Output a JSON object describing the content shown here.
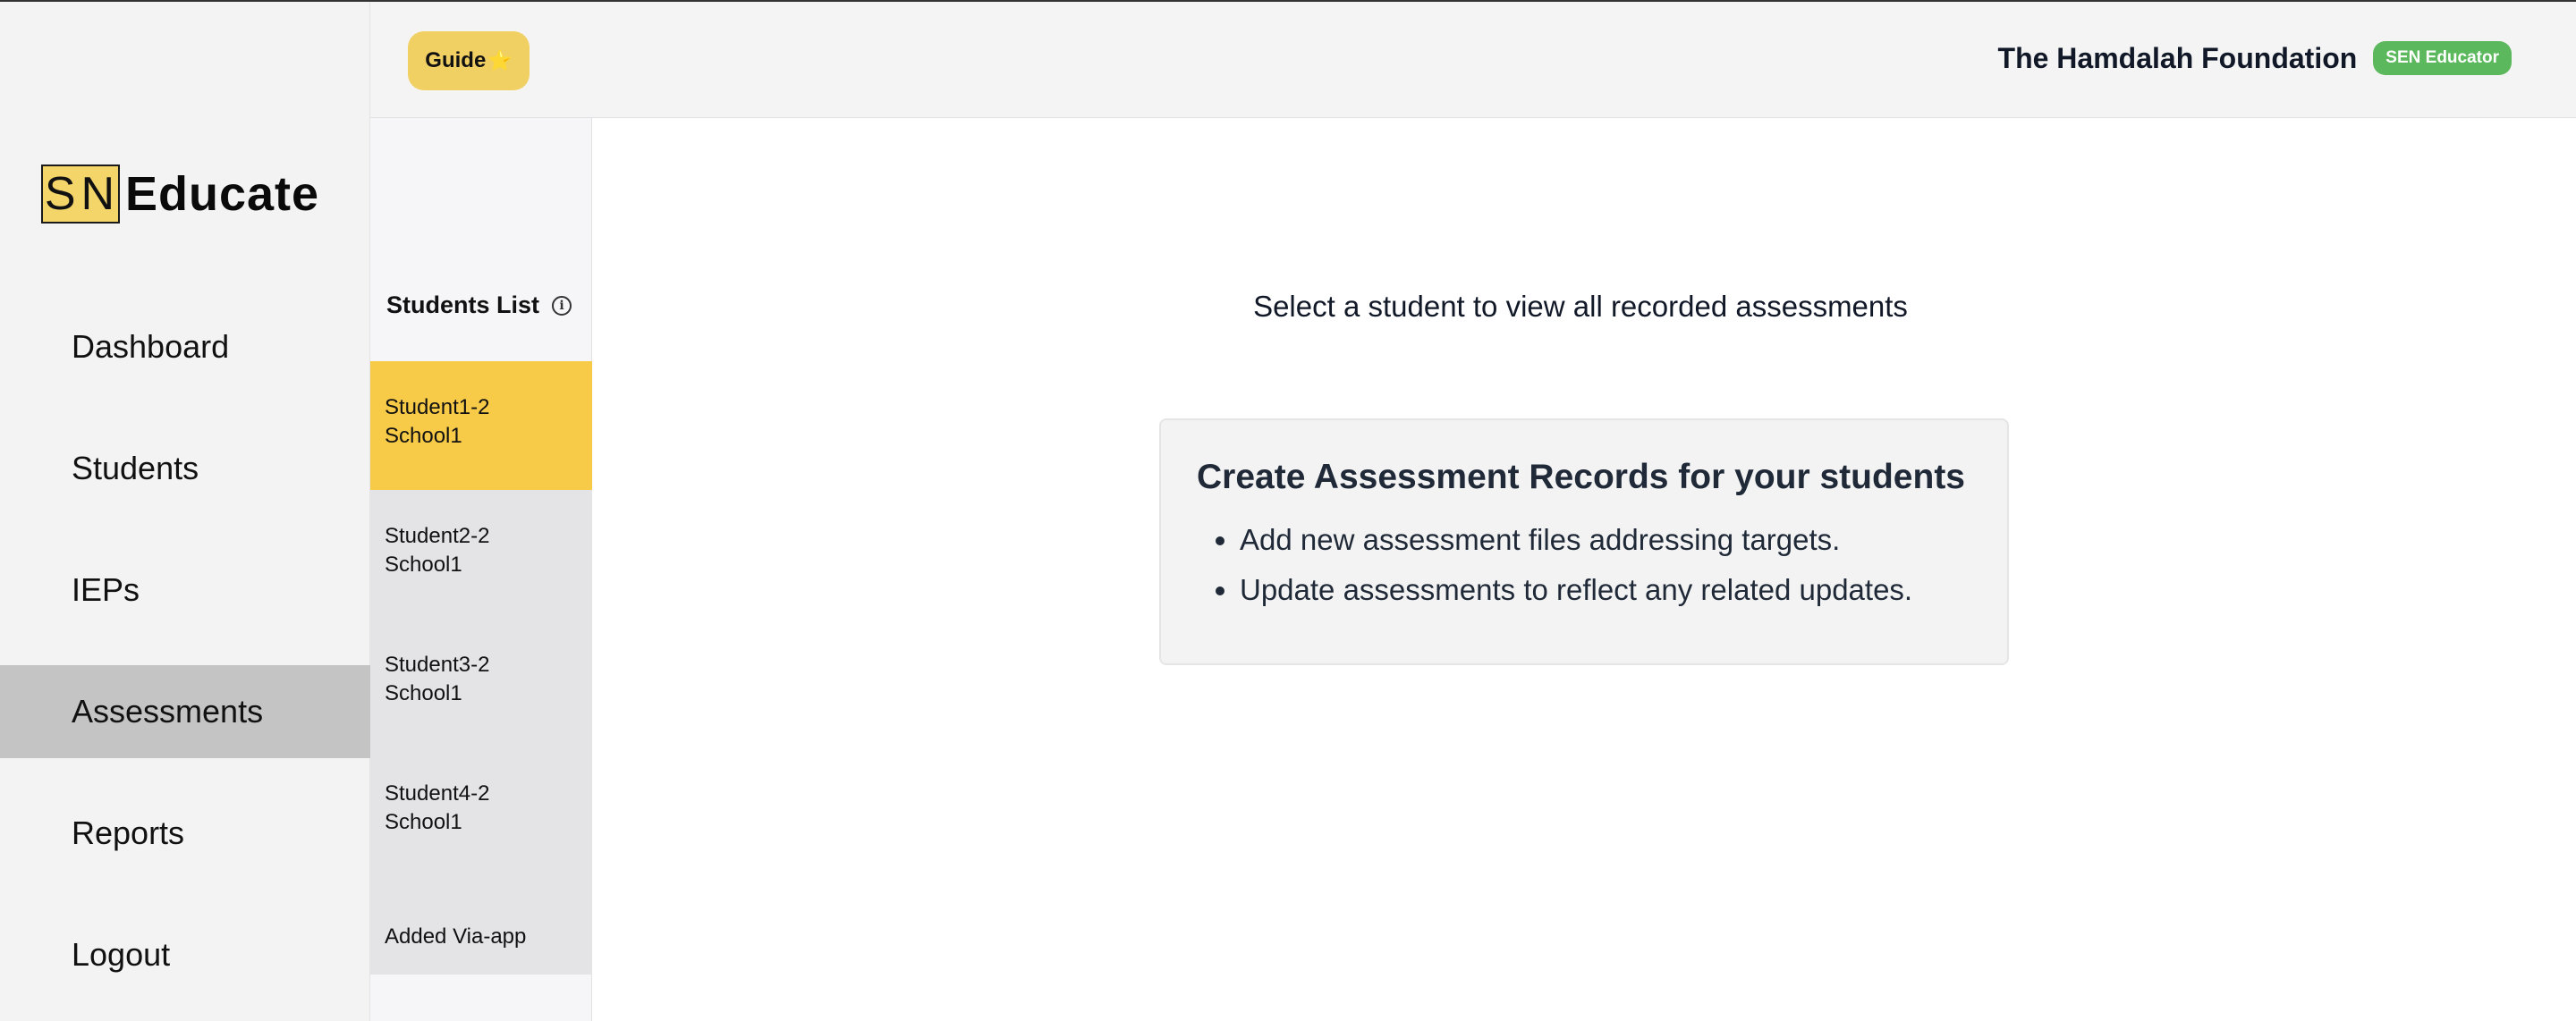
{
  "logo": {
    "sn": "SN",
    "word": "Educate"
  },
  "nav": {
    "items": [
      {
        "label": "Dashboard"
      },
      {
        "label": "Students"
      },
      {
        "label": "IEPs"
      },
      {
        "label": "Assessments",
        "active": true
      },
      {
        "label": "Reports"
      },
      {
        "label": "Logout"
      }
    ]
  },
  "header": {
    "guide_label": "Guide",
    "guide_icon": "⭐",
    "org_name": "The Hamdalah Foundation",
    "role_badge": "SEN Educator"
  },
  "students": {
    "title": "Students List",
    "info_icon": "i",
    "items": [
      {
        "line1": "Student1-2",
        "line2": "School1",
        "active": true
      },
      {
        "line1": "Student2-2",
        "line2": "School1"
      },
      {
        "line1": "Student3-2",
        "line2": "School1"
      },
      {
        "line1": "Student4-2",
        "line2": "School1"
      },
      {
        "line1": "Added Via-app",
        "line2": ""
      }
    ]
  },
  "main": {
    "prompt": "Select a student to view all recorded assessments",
    "card": {
      "title": "Create Assessment Records for your students",
      "bullets": [
        "Add new assessment files addressing targets.",
        "Update assessments to reflect any related updates."
      ]
    }
  },
  "colors": {
    "accent_yellow": "#f7ca48",
    "badge_green": "#5cb85c",
    "nav_active": "#c4c4c4"
  }
}
